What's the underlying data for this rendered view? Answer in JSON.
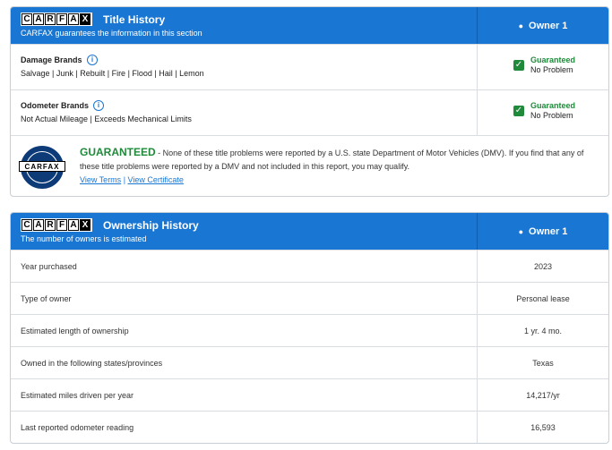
{
  "title_history": {
    "logo_letters": [
      "C",
      "A",
      "R",
      "F",
      "A",
      "X"
    ],
    "title": "Title History",
    "subtitle": "CARFAX guarantees the information in this section",
    "owner_label": "Owner 1",
    "damage": {
      "name": "Damage Brands",
      "list": "Salvage | Junk | Rebuilt | Fire | Flood | Hail | Lemon",
      "status_title": "Guaranteed",
      "status_text": "No Problem"
    },
    "odometer": {
      "name": "Odometer Brands",
      "list": "Not Actual Mileage | Exceeds Mechanical Limits",
      "status_title": "Guaranteed",
      "status_text": "No Problem"
    },
    "guarantee": {
      "headline": "GUARANTEED",
      "text": " - None of these title problems were reported by a U.S. state Department of Motor Vehicles (DMV). If you find that any of these title problems were reported by a DMV and not included in this report, you may qualify.",
      "link_terms": "View Terms",
      "separator": " | ",
      "link_certificate": "View Certificate",
      "seal_text": "CARFAX"
    }
  },
  "ownership_history": {
    "logo_letters": [
      "C",
      "A",
      "R",
      "F",
      "A",
      "X"
    ],
    "title": "Ownership History",
    "subtitle": "The number of owners is estimated",
    "owner_label": "Owner 1",
    "rows": [
      {
        "label": "Year purchased",
        "value": "2023"
      },
      {
        "label": "Type of owner",
        "value": "Personal lease"
      },
      {
        "label": "Estimated length of ownership",
        "value": "1 yr. 4 mo."
      },
      {
        "label": "Owned in the following states/provinces",
        "value": "Texas"
      },
      {
        "label": "Estimated miles driven per year",
        "value": "14,217/yr"
      },
      {
        "label": "Last reported odometer reading",
        "value": "16,593"
      }
    ]
  },
  "icons": {
    "info": "info-icon",
    "check": "checkmark-icon",
    "person": "person-icon"
  },
  "colors": {
    "header_blue": "#1976d2",
    "guaranteed_green": "#1f8a3a",
    "seal_navy": "#0d3b78"
  }
}
